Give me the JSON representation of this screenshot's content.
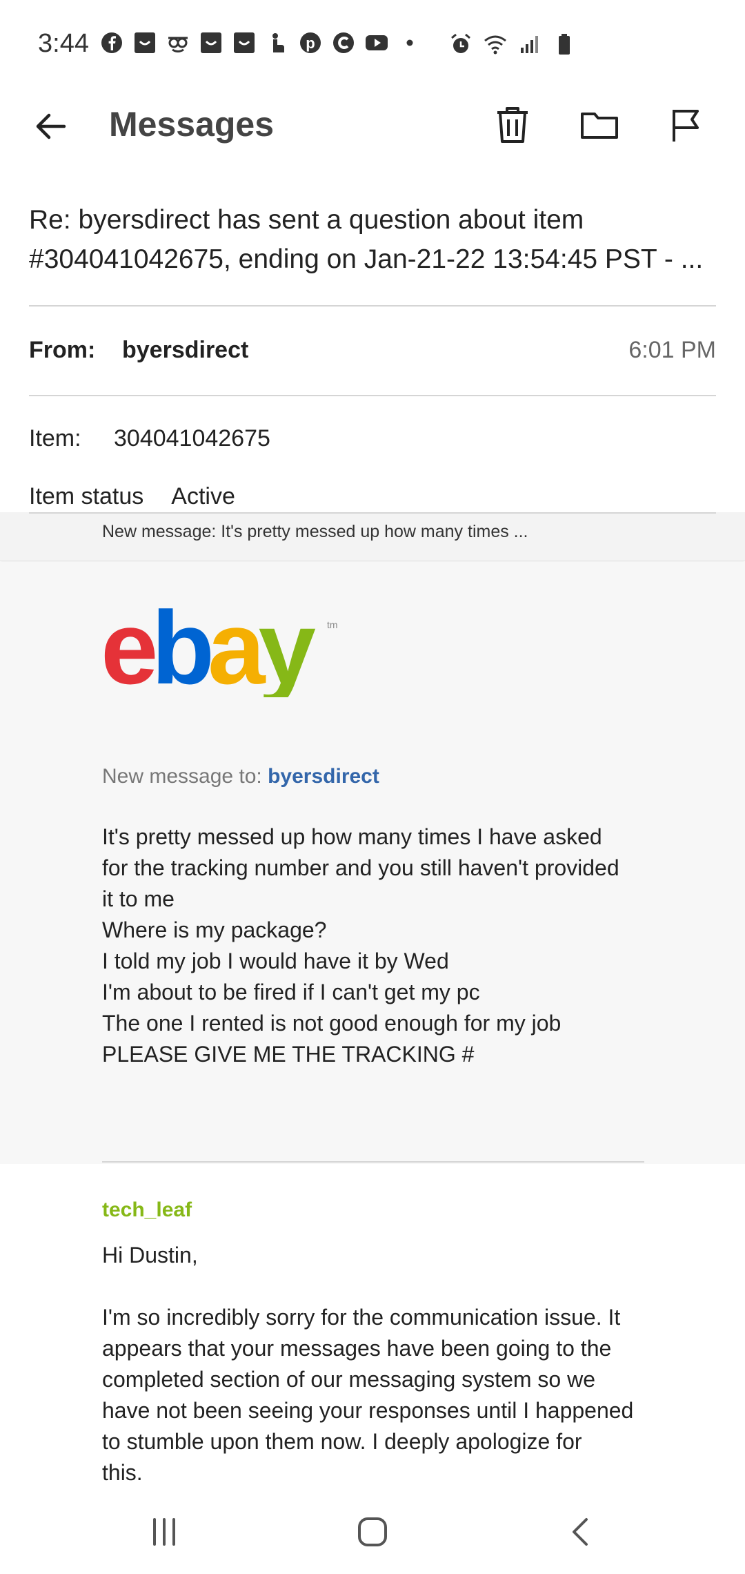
{
  "status_bar": {
    "time": "3:44",
    "left_icons": [
      "facebook-icon",
      "app-box-icon",
      "glasses-icon",
      "app-box-icon",
      "app-box-icon",
      "touch-icon",
      "pinterest-icon",
      "c-app-icon",
      "youtube-icon",
      "dot-icon"
    ],
    "right_icons": [
      "alarm-icon",
      "wifi-icon",
      "signal-icon",
      "battery-icon"
    ]
  },
  "app_bar": {
    "title": "Messages",
    "actions": [
      "back-arrow-icon",
      "trash-icon",
      "folder-icon",
      "flag-icon"
    ]
  },
  "subject": {
    "line1": "Re: byersdirect has sent a question about item",
    "line2": "#304041042675, ending on Jan-21-22 13:54:45 PST - ..."
  },
  "header": {
    "from_label": "From:",
    "from_value": "byersdirect",
    "time": "6:01 PM",
    "item_label": "Item:",
    "item_value": "304041042675",
    "item_status_label": "Item status",
    "item_status_value": "Active"
  },
  "preview": {
    "text": "New message: It's pretty messed up how many times ..."
  },
  "message": {
    "logo_tm": "tm",
    "to_prefix": "New message to: ",
    "to_recipient": "byersdirect",
    "body_lines": [
      "It's pretty messed up how many times I have asked",
      "for the tracking number and you still haven't provided",
      "it to me",
      "Where is my package?",
      "I told my job I would have it by Wed",
      "I'm about to be fired if I can't get my pc",
      "The one I rented is not good enough for my job",
      "PLEASE GIVE ME THE TRACKING #"
    ]
  },
  "reply": {
    "author": "tech_leaf",
    "greeting": "Hi Dustin,",
    "body_lines": [
      "I'm so incredibly sorry for the communication issue. It",
      "appears that your messages have been going to the",
      "completed section of our messaging system so we",
      "have not been seeing your responses until I happened",
      "to stumble upon them now. I deeply apologize for",
      "this."
    ]
  },
  "nav_bar": {
    "buttons": [
      "recent-apps-icon",
      "home-icon",
      "nav-back-icon"
    ]
  },
  "colors": {
    "ebay_red": "#e53238",
    "ebay_blue": "#0064d2",
    "ebay_yellow": "#f5af02",
    "ebay_green": "#86b817",
    "link_blue": "#3366aa",
    "panel_bg": "#f7f7f7"
  }
}
